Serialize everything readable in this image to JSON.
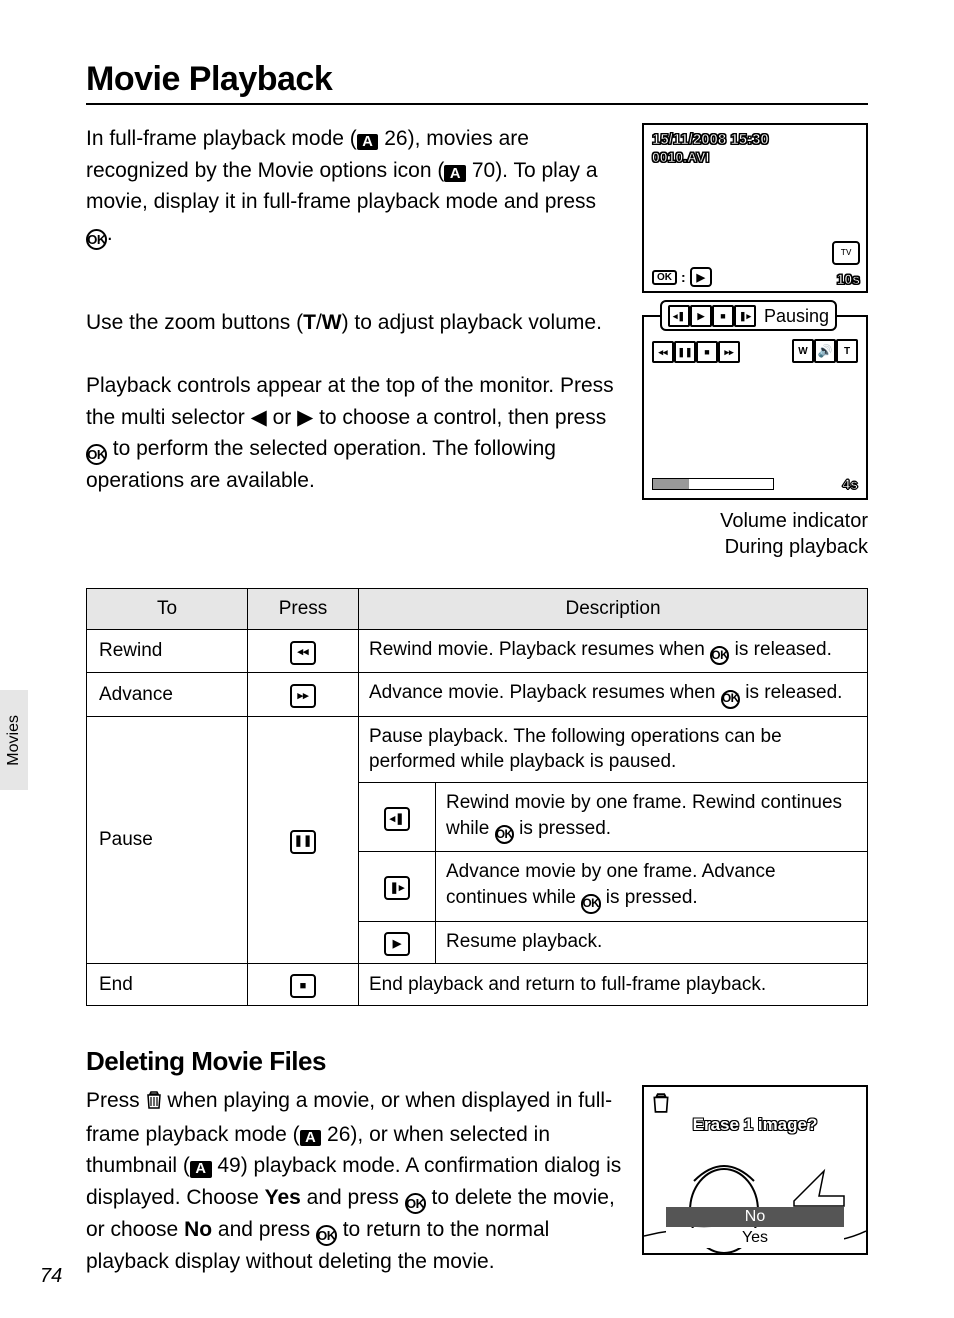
{
  "page": {
    "number": "74",
    "sideTab": "Movies"
  },
  "title": "Movie Playback",
  "intro": {
    "p1a": "In full-frame playback mode (",
    "p1b": " 26), movies are recognized by the Movie options icon (",
    "p1c": " 70). To play a movie, display it in full-frame playback mode and press ",
    "p1d": "."
  },
  "para2": {
    "a": "Use the zoom buttons (",
    "t": "T",
    "slash": "/",
    "w": "W",
    "b": ") to adjust playback volume.",
    "c": "Playback controls appear at the top of the monitor. Press the multi selector ",
    "d": " or ",
    "e": " to choose a control, then press ",
    "f": " to perform the selected operation. The following operations are available."
  },
  "diag1": {
    "date": "15/11/2008 15:30",
    "file": "0010.AVI",
    "bottom": "10s"
  },
  "pausingLabel": "Pausing",
  "diag2": {
    "time": "4s"
  },
  "caption1": "Volume indicator",
  "caption2": "During playback",
  "table": {
    "headers": {
      "to": "To",
      "press": "Press",
      "desc": "Description"
    },
    "rows": {
      "rewind": {
        "label": "Rewind",
        "sym": "◂◂",
        "desc_a": "Rewind movie. Playback resumes when ",
        "desc_b": " is released."
      },
      "advance": {
        "label": "Advance",
        "sym": "▸▸",
        "desc_a": "Advance movie. Playback resumes when ",
        "desc_b": " is released."
      },
      "pause": {
        "label": "Pause",
        "sym": "❚❚",
        "desc": "Pause playback. The following operations can be performed while playback is paused.",
        "sub1": {
          "sym": "◂❚",
          "a": "Rewind movie by one frame. Rewind continues while ",
          "b": " is pressed."
        },
        "sub2": {
          "sym": "❚▸",
          "a": "Advance movie by one frame. Advance continues while ",
          "b": " is pressed."
        },
        "sub3": {
          "sym": "▶",
          "a": "Resume playback."
        }
      },
      "end": {
        "label": "End",
        "sym": "■",
        "desc": "End playback and return to full-frame playback."
      }
    }
  },
  "delete": {
    "heading": "Deleting Movie Files",
    "a": "Press ",
    "b": " when playing a movie, or when displayed in full-frame playback mode (",
    "c": " 26), or when selected in thumbnail (",
    "d": " 49) playback mode. A confirmation dialog is displayed. Choose ",
    "yes": "Yes",
    "e": " and press ",
    "f": " to delete the movie, or choose ",
    "no": "No",
    "g": " and press ",
    "h": " to return to the normal playback display without deleting the movie."
  },
  "delDiag": {
    "prompt": "Erase 1 image?",
    "no": "No",
    "yes": "Yes"
  }
}
